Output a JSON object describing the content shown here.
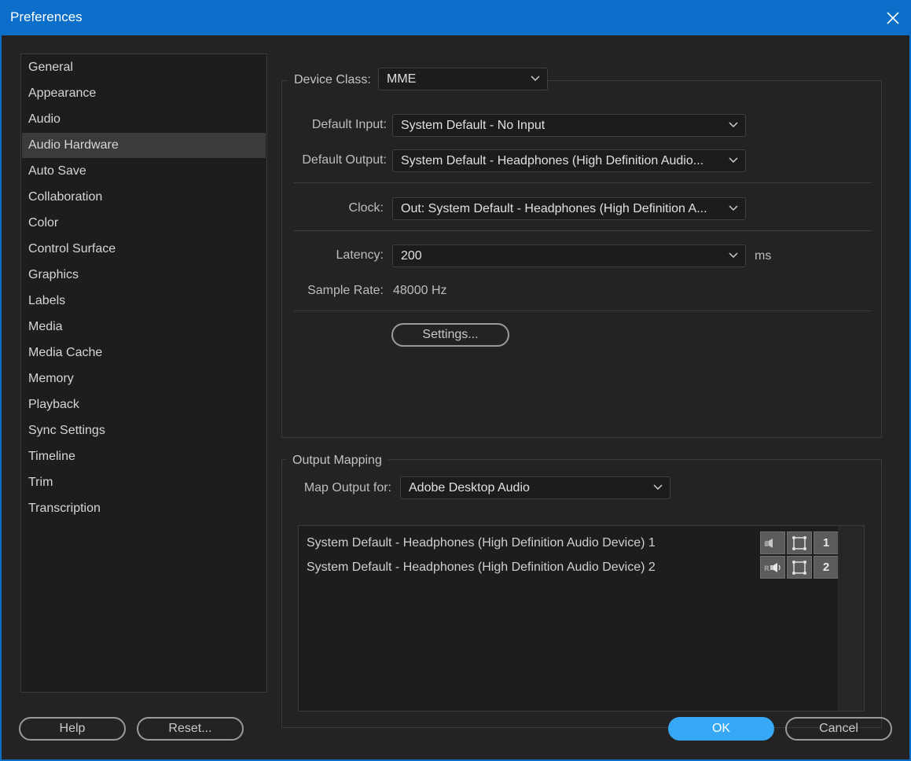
{
  "window": {
    "title": "Preferences"
  },
  "sidebar": {
    "items": [
      {
        "label": "General"
      },
      {
        "label": "Appearance"
      },
      {
        "label": "Audio"
      },
      {
        "label": "Audio Hardware",
        "active": true
      },
      {
        "label": "Auto Save"
      },
      {
        "label": "Collaboration"
      },
      {
        "label": "Color"
      },
      {
        "label": "Control Surface"
      },
      {
        "label": "Graphics"
      },
      {
        "label": "Labels"
      },
      {
        "label": "Media"
      },
      {
        "label": "Media Cache"
      },
      {
        "label": "Memory"
      },
      {
        "label": "Playback"
      },
      {
        "label": "Sync Settings"
      },
      {
        "label": "Timeline"
      },
      {
        "label": "Trim"
      },
      {
        "label": "Transcription"
      }
    ]
  },
  "audio_hardware": {
    "device_class_label": "Device Class:",
    "device_class_value": "MME",
    "default_input_label": "Default Input:",
    "default_input_value": "System Default - No Input",
    "default_output_label": "Default Output:",
    "default_output_value": "System Default - Headphones (High Definition Audio...",
    "clock_label": "Clock:",
    "clock_value": "Out: System Default - Headphones (High Definition A...",
    "latency_label": "Latency:",
    "latency_value": "200",
    "latency_unit": "ms",
    "sample_rate_label": "Sample Rate:",
    "sample_rate_value": "48000 Hz",
    "settings_button": "Settings..."
  },
  "output_mapping": {
    "group_label": "Output Mapping",
    "map_output_label": "Map Output for:",
    "map_output_value": "Adobe Desktop Audio",
    "channels": [
      {
        "name": "System Default - Headphones (High Definition Audio Device) 1",
        "number": "1"
      },
      {
        "name": "System Default - Headphones (High Definition Audio Device) 2",
        "number": "2"
      }
    ]
  },
  "footer": {
    "help": "Help",
    "reset": "Reset...",
    "ok": "OK",
    "cancel": "Cancel"
  },
  "colors": {
    "titlebar": "#0b6fc9",
    "background": "#232323",
    "accent_button": "#36a8f5"
  }
}
